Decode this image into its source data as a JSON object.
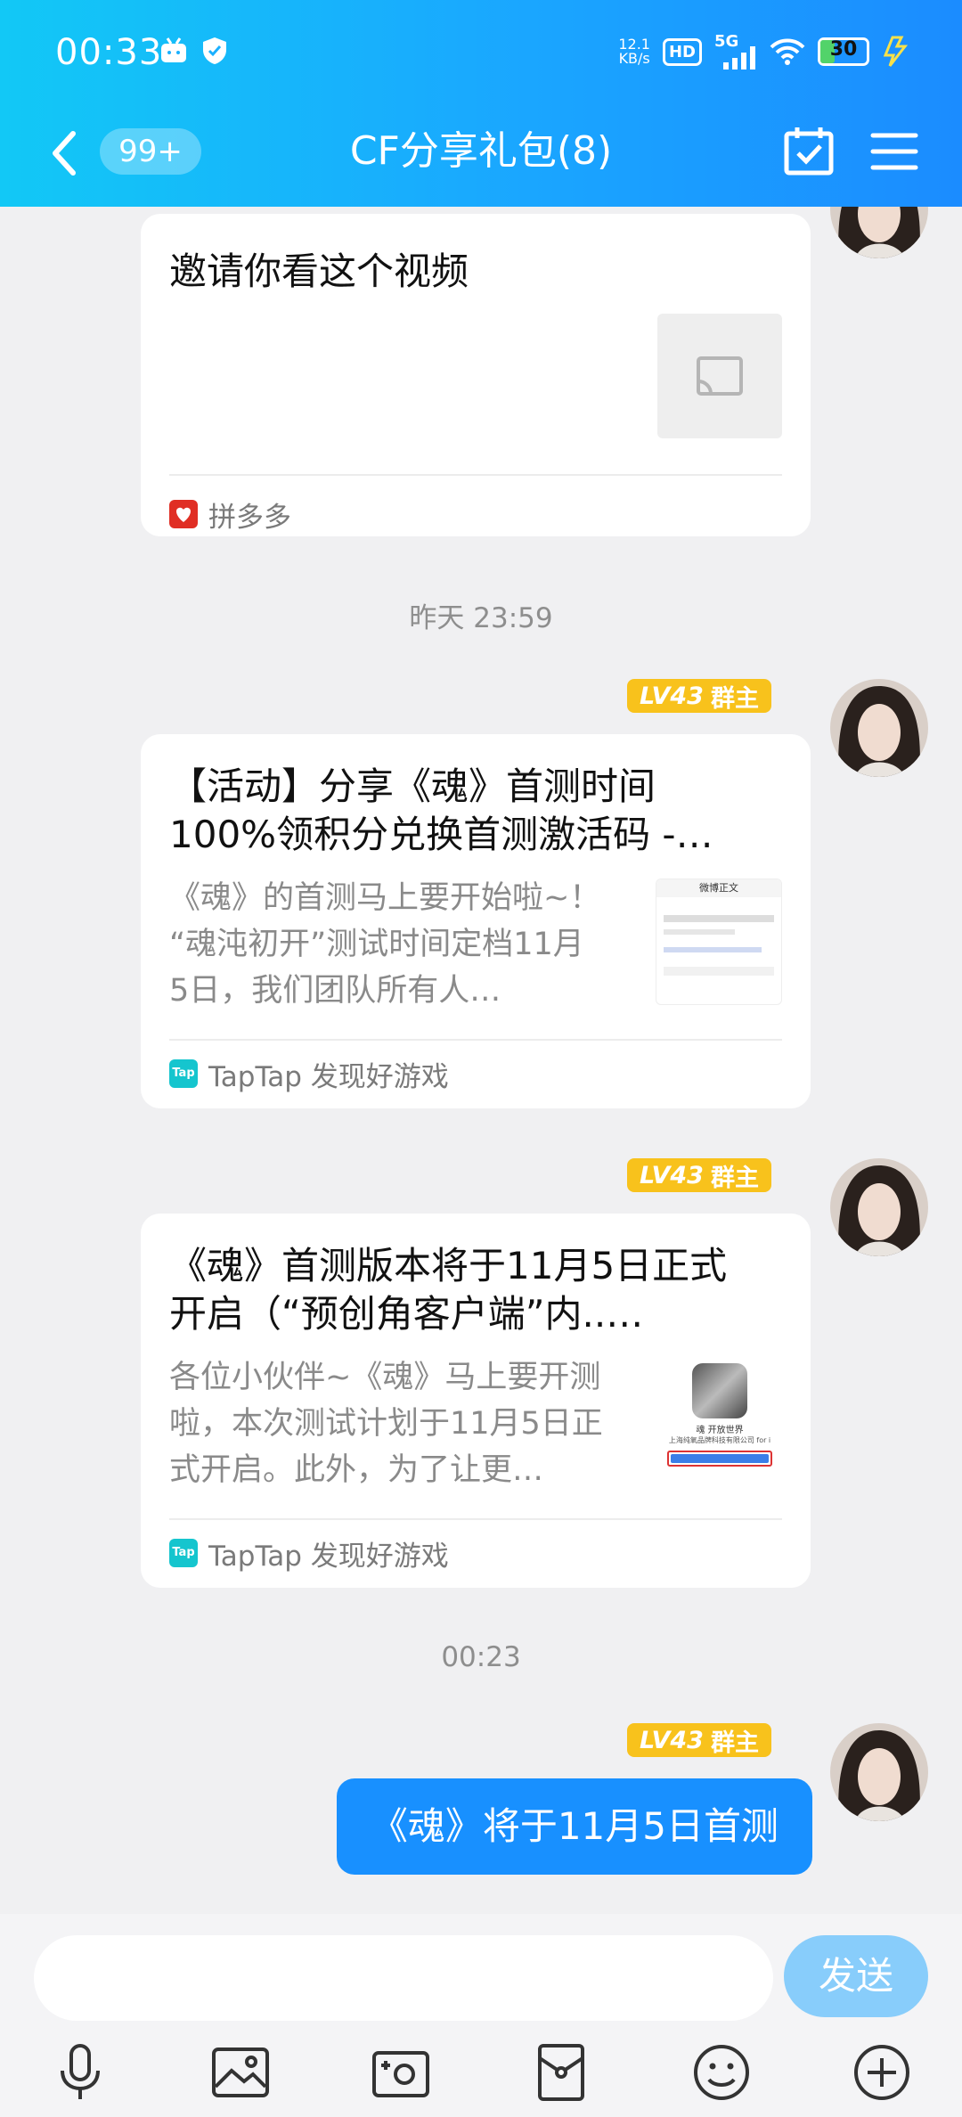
{
  "status_bar": {
    "time": "00:33",
    "net_speed_value": "12.1",
    "net_speed_unit": "KB/s",
    "hd_label": "HD",
    "network_label": "5G",
    "battery_level": "30",
    "battery_percent": 30
  },
  "header": {
    "unread_count": "99+",
    "title": "CF分享礼包(8)"
  },
  "messages": {
    "msg1": {
      "title": "邀请你看这个视频",
      "source": "拼多多"
    },
    "timestamp1": "昨天 23:59",
    "msg2": {
      "badge_level": "LV43",
      "badge_role": "群主",
      "title_line1": "【活动】分享《魂》首测时间",
      "title_line2": "100%领积分兑换首测激活码 -…",
      "desc_line1": "《魂》的首测马上要开始啦~！",
      "desc_line2": "“魂沌初开”测试时间定档11月",
      "desc_line3": "5日，我们团队所有人…",
      "source": "TapTap 发现好游戏",
      "thumb_header": "微博正文"
    },
    "msg3": {
      "badge_level": "LV43",
      "badge_role": "群主",
      "title_line1": "《魂》首测版本将于11月5日正式",
      "title_line2": "开启（“预创角客户端”内..…",
      "desc_line1": "各位小伙伴~《魂》马上要开测",
      "desc_line2": "啦，本次测试计划于11月5日正",
      "desc_line3": "式开启。此外，为了让更…",
      "source": "TapTap 发现好游戏",
      "thumb_caption1": "魂 开放世界",
      "thumb_caption2": "上海纯氧品牌科技有限公司 for i"
    },
    "timestamp2": "00:23",
    "msg4": {
      "badge_level": "LV43",
      "badge_role": "群主",
      "text": "《魂》将于11月5日首测"
    }
  },
  "taptap_logo_text": "Tap",
  "input_bar": {
    "placeholder": "",
    "send_label": "发送"
  },
  "colors": {
    "header_gradient_start": "#12c8f6",
    "header_gradient_end": "#1b8cff",
    "my_bubble": "#1890ff",
    "send_button": "#88cdfb",
    "badge": "#f8c21c",
    "background": "#f0f0f2"
  },
  "icons": {
    "status_left": [
      "bilibili-tv-icon",
      "shield-check-icon"
    ],
    "status_right": [
      "hd-icon",
      "5g-signal-icon",
      "wifi-icon",
      "battery-icon",
      "charging-icon"
    ],
    "header": [
      "back-chevron-icon",
      "calendar-check-icon",
      "menu-icon"
    ],
    "toolbar": [
      "microphone-icon",
      "image-icon",
      "camera-icon",
      "red-packet-icon",
      "emoji-icon",
      "plus-icon"
    ]
  }
}
